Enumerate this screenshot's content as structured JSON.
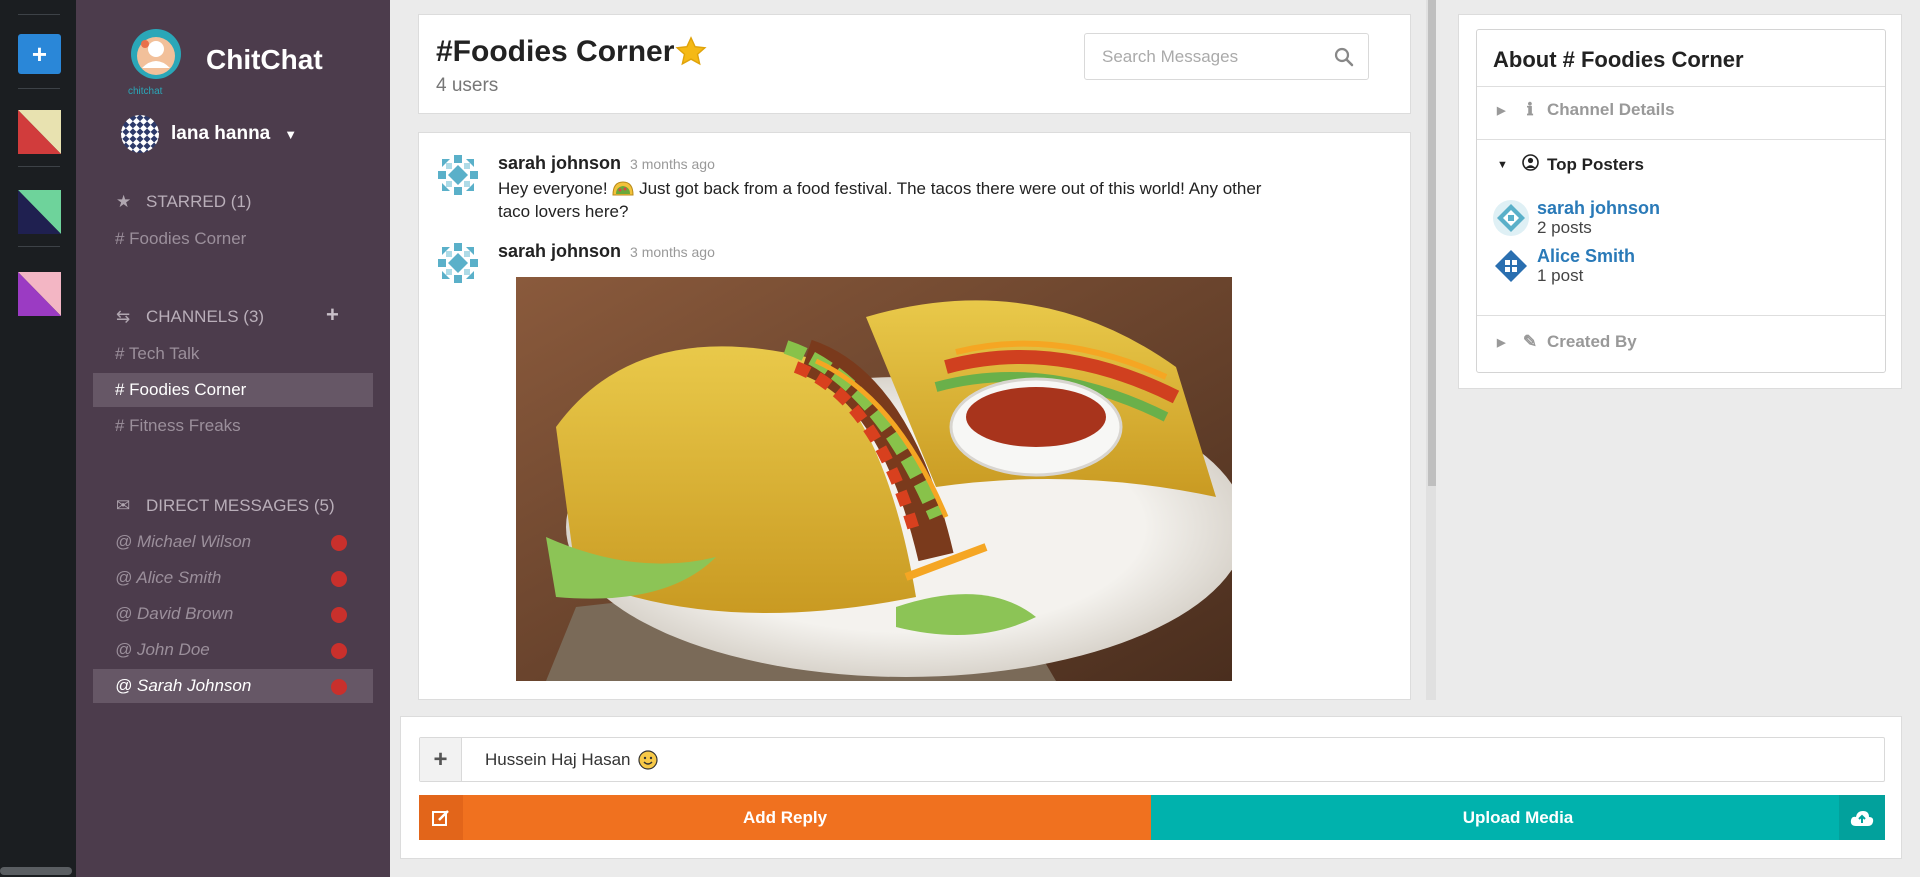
{
  "app": {
    "name": "ChitChat",
    "logo_subtitle": "chitchat"
  },
  "user": {
    "name": "lana hanna"
  },
  "sidebar": {
    "starred": {
      "label": "STARRED (1)",
      "items": [
        "# Foodies Corner"
      ]
    },
    "channels": {
      "label": "CHANNELS (3)",
      "items": [
        "# Tech Talk",
        "# Foodies Corner",
        "# Fitness Freaks"
      ]
    },
    "direct_messages": {
      "label": "DIRECT MESSAGES (5)",
      "items": [
        "@ Michael Wilson",
        "@ Alice Smith",
        "@ David Brown",
        "@ John Doe",
        "@ Sarah Johnson"
      ]
    }
  },
  "header": {
    "title": "#Foodies Corner",
    "users": "4 users",
    "search_placeholder": "Search Messages"
  },
  "messages": [
    {
      "author": "sarah johnson",
      "time": "3 months ago",
      "text_before": "Hey everyone! ",
      "text_after": " Just got back from a food festival. The tacos there were out of this world! Any other taco lovers here?"
    },
    {
      "author": "sarah johnson",
      "time": "3 months ago"
    }
  ],
  "about": {
    "title": "About # Foodies Corner",
    "channel_details": "Channel Details",
    "top_posters": "Top Posters",
    "created_by": "Created By",
    "posters": [
      {
        "name": "sarah johnson",
        "count": "2 posts"
      },
      {
        "name": "Alice Smith",
        "count": "1 post"
      }
    ]
  },
  "composer": {
    "value": "Hussein Haj Hasan",
    "add_reply": "Add Reply",
    "upload_media": "Upload Media"
  },
  "colors": {
    "sidebar": "#4c3c4c",
    "rail": "#1b1e21",
    "reply_button": "#f0711f",
    "upload_button": "#00b2ad",
    "unread_dot": "#c9302c",
    "link": "#2a7ab8"
  },
  "icons": {
    "star": "star-icon",
    "channels": "exchange-icon",
    "dm": "envelope-icon",
    "search": "search-icon",
    "info": "info-icon",
    "user": "user-circle-icon",
    "pencil": "pencil-icon",
    "edit": "edit-icon",
    "upload": "cloud-upload-icon"
  }
}
